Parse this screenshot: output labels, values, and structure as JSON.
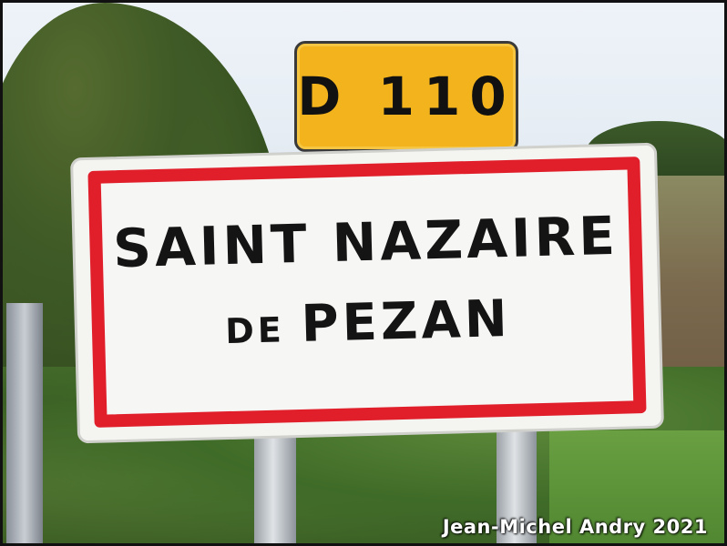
{
  "route_sign": {
    "label": "D 110",
    "color": "#f2b31c"
  },
  "town_sign": {
    "line1": "SAINT NAZAIRE",
    "line2_prefix": "DE",
    "line2_name": "PEZAN",
    "border_color": "#e01f2b"
  },
  "watermark": "Jean-Michel Andry 2021"
}
